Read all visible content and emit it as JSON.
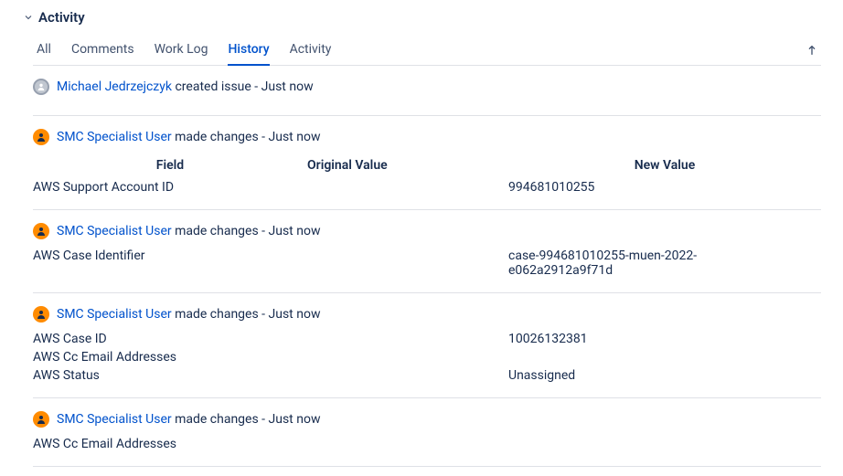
{
  "section": {
    "title": "Activity"
  },
  "tabs": {
    "all": "All",
    "comments": "Comments",
    "worklog": "Work Log",
    "history": "History",
    "activity": "Activity"
  },
  "headers": {
    "field": "Field",
    "original": "Original Value",
    "new": "New Value"
  },
  "entries": {
    "0": {
      "user": "Michael Jedrzejczyk",
      "action": "created issue - Just now"
    },
    "1": {
      "user": "SMC Specialist User",
      "action": "made changes - Just now",
      "rows": {
        "0": {
          "field": "AWS Support Account ID",
          "orig": "",
          "new": "994681010255"
        }
      }
    },
    "2": {
      "user": "SMC Specialist User",
      "action": "made changes - Just now",
      "rows": {
        "0": {
          "field": "AWS Case Identifier",
          "orig": "",
          "new": "case-994681010255-muen-2022-e062a2912a9f71d"
        }
      }
    },
    "3": {
      "user": "SMC Specialist User",
      "action": "made changes - Just now",
      "rows": {
        "0": {
          "field": "AWS Case ID",
          "orig": "",
          "new": "10026132381"
        },
        "1": {
          "field": "AWS Cc Email Addresses",
          "orig": "",
          "new": ""
        },
        "2": {
          "field": "AWS Status",
          "orig": "",
          "new": "Unassigned"
        }
      }
    },
    "4": {
      "user": "SMC Specialist User",
      "action": "made changes - Just now",
      "rows": {
        "0": {
          "field": "AWS Cc Email Addresses",
          "orig": "",
          "new": ""
        }
      }
    }
  }
}
